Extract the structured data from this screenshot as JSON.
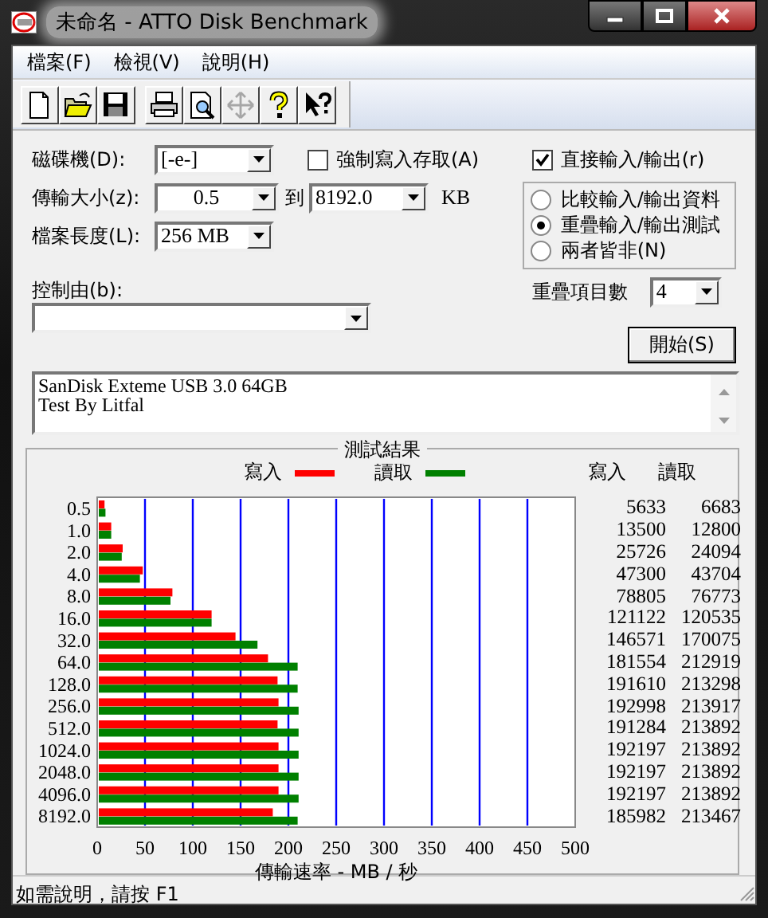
{
  "window": {
    "title": "未命名 - ATTO Disk Benchmark"
  },
  "menu": [
    {
      "label": "檔案(F)"
    },
    {
      "label": "檢視(V)"
    },
    {
      "label": "說明(H)"
    }
  ],
  "toolbar": [
    {
      "items": [
        {
          "kind": "new",
          "disabled": false
        },
        {
          "kind": "open",
          "disabled": false
        },
        {
          "kind": "save",
          "disabled": false
        }
      ]
    },
    {
      "items": [
        {
          "kind": "print",
          "disabled": false
        },
        {
          "kind": "preview",
          "disabled": false
        },
        {
          "kind": "move",
          "disabled": true
        },
        {
          "kind": "help",
          "disabled": false
        },
        {
          "kind": "context-help",
          "disabled": false
        }
      ]
    }
  ],
  "settings": {
    "drive": {
      "label": "磁碟機(D):",
      "value": "[-e-]"
    },
    "transfer_size": {
      "label": "傳輸大小(z):",
      "from": "0.5",
      "to_label": "到",
      "to": "8192.0",
      "unit": "KB"
    },
    "file_length": {
      "label": "檔案長度(L):",
      "value": "256 MB"
    },
    "force_write": {
      "label": "強制寫入存取(A)",
      "checked": false
    },
    "direct_io": {
      "label": "直接輸入/輸出(r)",
      "checked": true
    },
    "io_modes": [
      {
        "label": "比較輸入/輸出資料",
        "selected": false
      },
      {
        "label": "重疊輸入/輸出測試",
        "selected": true
      },
      {
        "label": "兩者皆非(N)",
        "selected": false
      }
    ],
    "queue_depth": {
      "label": "重疊項目數",
      "value": "4"
    },
    "controlled_by": {
      "label": "控制由(b):"
    },
    "start_button": "開始(S)"
  },
  "notes": [
    "SanDisk Exteme USB 3.0 64GB",
    "Test By Litfal"
  ],
  "results": {
    "title": "測試結果",
    "columns": [
      "寫入",
      "讀取"
    ],
    "rows": [
      {
        "write": "5633",
        "read": "6683"
      },
      {
        "write": "13500",
        "read": "12800"
      },
      {
        "write": "25726",
        "read": "24094"
      },
      {
        "write": "47300",
        "read": "43704"
      },
      {
        "write": "78805",
        "read": "76773"
      },
      {
        "write": "121122",
        "read": "120535"
      },
      {
        "write": "146571",
        "read": "170075"
      },
      {
        "write": "181554",
        "read": "212919"
      },
      {
        "write": "191610",
        "read": "213298"
      },
      {
        "write": "192998",
        "read": "213917"
      },
      {
        "write": "191284",
        "read": "213892"
      },
      {
        "write": "192197",
        "read": "213892"
      },
      {
        "write": "192197",
        "read": "213892"
      },
      {
        "write": "192197",
        "read": "213892"
      },
      {
        "write": "185982",
        "read": "213467"
      }
    ],
    "chart_data": {
      "type": "bar",
      "orientation": "horizontal",
      "xlabel": "傳輸速率 - MB / 秒",
      "categories": [
        "0.5",
        "1.0",
        "2.0",
        "4.0",
        "8.0",
        "16.0",
        "32.0",
        "64.0",
        "128.0",
        "256.0",
        "512.0",
        "1024.0",
        "2048.0",
        "4096.0",
        "8192.0"
      ],
      "series": [
        {
          "name": "寫入",
          "color": "#ff0000",
          "values": [
            6,
            13,
            25,
            46,
            77,
            118,
            143,
            177,
            187,
            188,
            187,
            188,
            188,
            188,
            182
          ]
        },
        {
          "name": "讀取",
          "color": "#008000",
          "values": [
            7,
            13,
            24,
            43,
            75,
            118,
            166,
            208,
            208,
            209,
            209,
            209,
            209,
            209,
            208
          ]
        }
      ],
      "xlim": [
        0,
        500
      ],
      "xticks": [
        0,
        50,
        100,
        150,
        200,
        250,
        300,
        350,
        400,
        450,
        500
      ],
      "grid": true
    }
  },
  "status_bar": "如需說明，請按 F1"
}
